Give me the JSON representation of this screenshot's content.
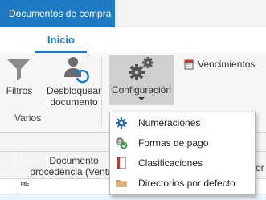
{
  "window": {
    "tab_title": "Documentos de compra"
  },
  "ribbon": {
    "active_tab": "Inicio",
    "buttons": {
      "filtros": "Filtros",
      "desbloquear_line1": "Desbloquear",
      "desbloquear_line2": "documento",
      "configuracion": "Configuración",
      "vencimientos": "Vencimientos"
    },
    "group_label": "Varios"
  },
  "dropdown": {
    "items": [
      {
        "label": "Numeraciones",
        "icon": "gear-icon"
      },
      {
        "label": "Formas de pago",
        "icon": "payment-icon"
      },
      {
        "label": "Clasificaciones",
        "icon": "classification-book-icon"
      },
      {
        "label": "Directorios por defecto",
        "icon": "folder-icon"
      }
    ]
  },
  "grid": {
    "col_header_line1": "Documento",
    "col_header_line2": "procedencia (Ventas",
    "col_header_partial": "or",
    "filter_icon_text": "ᴿᴮᶜ"
  },
  "colors": {
    "accent": "#1e7ac4",
    "ribbon_bg": "#f6f6f6",
    "hover_bg": "#cfcfcf"
  }
}
